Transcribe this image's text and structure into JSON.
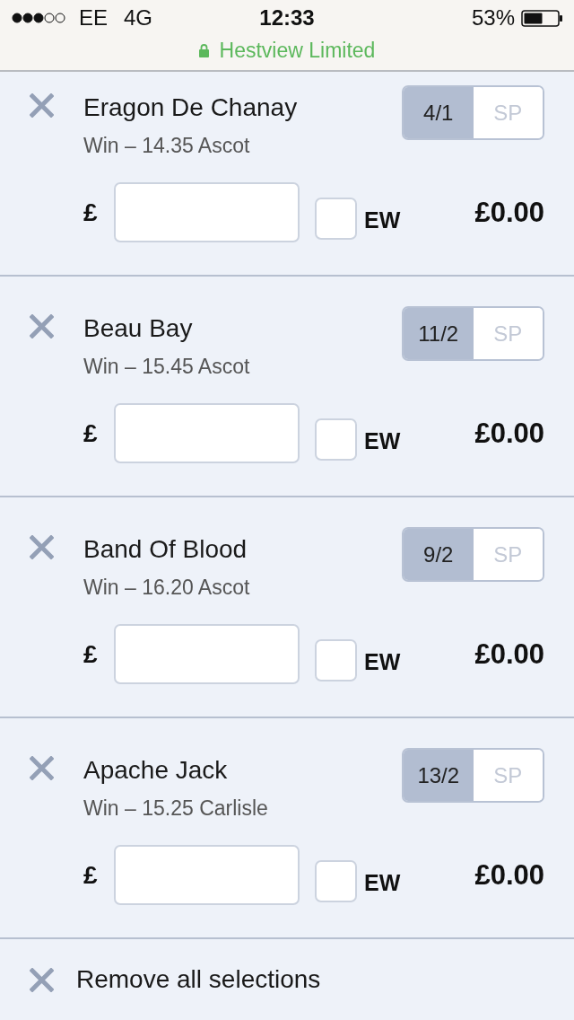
{
  "status_bar": {
    "carrier": "EE",
    "network": "4G",
    "time": "12:33",
    "battery": "53%",
    "site": "Hestview Limited"
  },
  "selections": [
    {
      "name": "Eragon De Chanay",
      "market": "Win – 14.35 Ascot",
      "odds": [
        {
          "label": "4/1",
          "selected": true
        },
        {
          "label": "SP",
          "selected": false
        }
      ],
      "currency": "£",
      "each_way": {
        "label": "EW",
        "checked": false
      },
      "returns": "£0.00"
    },
    {
      "name": "Beau Bay",
      "market": "Win – 15.45 Ascot",
      "odds": [
        {
          "label": "11/2",
          "selected": true
        },
        {
          "label": "SP",
          "selected": false
        }
      ],
      "currency": "£",
      "each_way": {
        "label": "EW",
        "checked": false
      },
      "returns": "£0.00"
    },
    {
      "name": "Band Of Blood",
      "market": "Win – 16.20 Ascot",
      "odds": [
        {
          "label": "9/2",
          "selected": true
        },
        {
          "label": "SP",
          "selected": false
        }
      ],
      "currency": "£",
      "each_way": {
        "label": "EW",
        "checked": false
      },
      "returns": "£0.00"
    },
    {
      "name": "Apache Jack",
      "market": "Win – 15.25 Carlisle",
      "odds": [
        {
          "label": "13/2",
          "selected": true
        },
        {
          "label": "SP",
          "selected": false
        }
      ],
      "currency": "£",
      "each_way": {
        "label": "EW",
        "checked": false
      },
      "returns": "£0.00"
    }
  ],
  "remove_all": "Remove all selections"
}
